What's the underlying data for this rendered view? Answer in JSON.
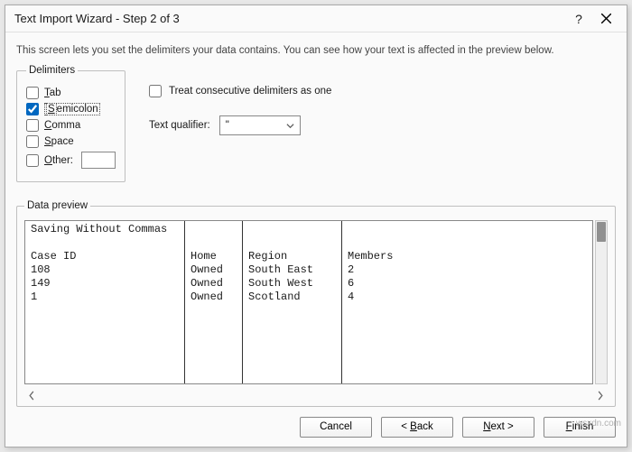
{
  "window": {
    "title": "Text Import Wizard - Step 2 of 3"
  },
  "description": "This screen lets you set the delimiters your data contains.  You can see how your text is affected in the preview below.",
  "delimiters": {
    "legend": "Delimiters",
    "tab": {
      "label": "Tab",
      "hotkey": "T",
      "checked": false
    },
    "semicolon": {
      "label": "Semicolon",
      "hotkey": "S",
      "checked": true
    },
    "comma": {
      "label": "Comma",
      "hotkey": "C",
      "checked": false
    },
    "space": {
      "label": "Space",
      "hotkey": "S",
      "checked": false
    },
    "other": {
      "label": "Other:",
      "hotkey": "O",
      "checked": false,
      "value": ""
    }
  },
  "consecutive": {
    "label_prefix": "T",
    "label_rest": "reat consecutive delimiters as one",
    "checked": false
  },
  "textQualifier": {
    "label": "Text qualifier:",
    "value": "\""
  },
  "preview": {
    "legend": "Data preview",
    "columns": [
      [
        "Saving Without Commas",
        "",
        "Case ID",
        "108",
        "149",
        "1"
      ],
      [
        "",
        "",
        "Home",
        "Owned",
        "Owned",
        "Owned"
      ],
      [
        "",
        "",
        "Region",
        "South East",
        "South West",
        "Scotland"
      ],
      [
        "",
        "",
        "Members",
        "2",
        "6",
        "4"
      ]
    ]
  },
  "buttons": {
    "cancel": "Cancel",
    "back": {
      "prefix": "< ",
      "hot": "B",
      "rest": "ack"
    },
    "next": {
      "hot": "N",
      "rest": "ext >"
    },
    "finish": {
      "hot": "F",
      "rest": "inish"
    }
  },
  "watermark": "wsxdn.com"
}
